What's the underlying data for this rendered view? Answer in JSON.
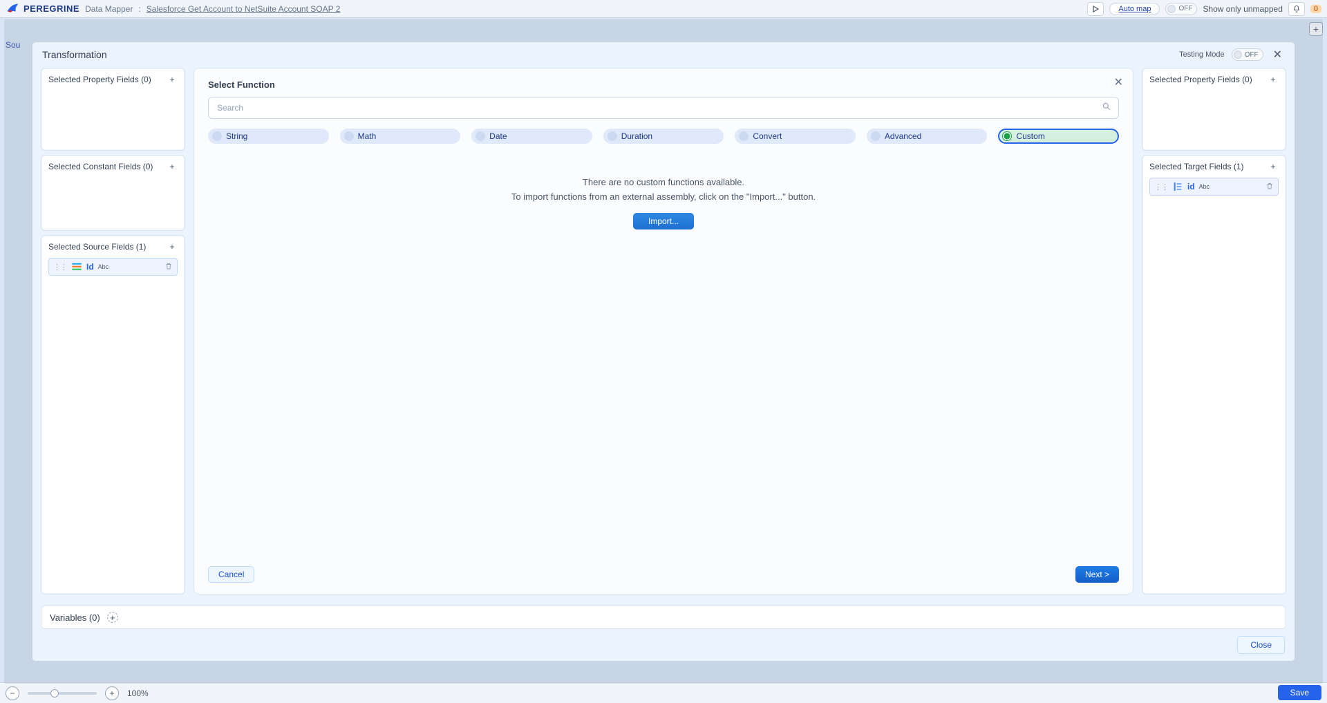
{
  "topbar": {
    "brand": "PEREGRINE",
    "crumb_section": "Data Mapper",
    "crumb_title": "Salesforce Get Account to NetSuite Account SOAP 2",
    "automap": "Auto map",
    "off": "OFF",
    "show_unmapped": "Show only unmapped",
    "warn_count": "0"
  },
  "modal": {
    "title": "Transformation",
    "testing_mode_label": "Testing Mode",
    "testing_mode_value": "OFF",
    "close_tooltip": "Close"
  },
  "left": {
    "property": "Selected Property Fields (0)",
    "constant": "Selected Constant Fields (0)",
    "source": "Selected Source Fields (1)",
    "source_field": {
      "id": "Id",
      "type": "Abc"
    }
  },
  "right": {
    "property": "Selected Property Fields (0)",
    "target": "Selected Target Fields (1)",
    "target_field": {
      "id": "id",
      "type": "Abc"
    }
  },
  "center": {
    "card_title": "Select Function",
    "search_placeholder": "Search",
    "categories": [
      "String",
      "Math",
      "Date",
      "Duration",
      "Convert",
      "Advanced",
      "Custom"
    ],
    "active_category_index": 6,
    "empty_line1": "There are no custom functions available.",
    "empty_line2": "To import functions from an external assembly, click on the \"Import...\" button.",
    "import": "Import...",
    "cancel": "Cancel",
    "next": "Next >"
  },
  "variables": {
    "label": "Variables (0)"
  },
  "actions": {
    "close": "Close"
  },
  "footer": {
    "zoom": "100%",
    "save": "Save"
  },
  "backdrop": {
    "source_label": "Sou"
  }
}
